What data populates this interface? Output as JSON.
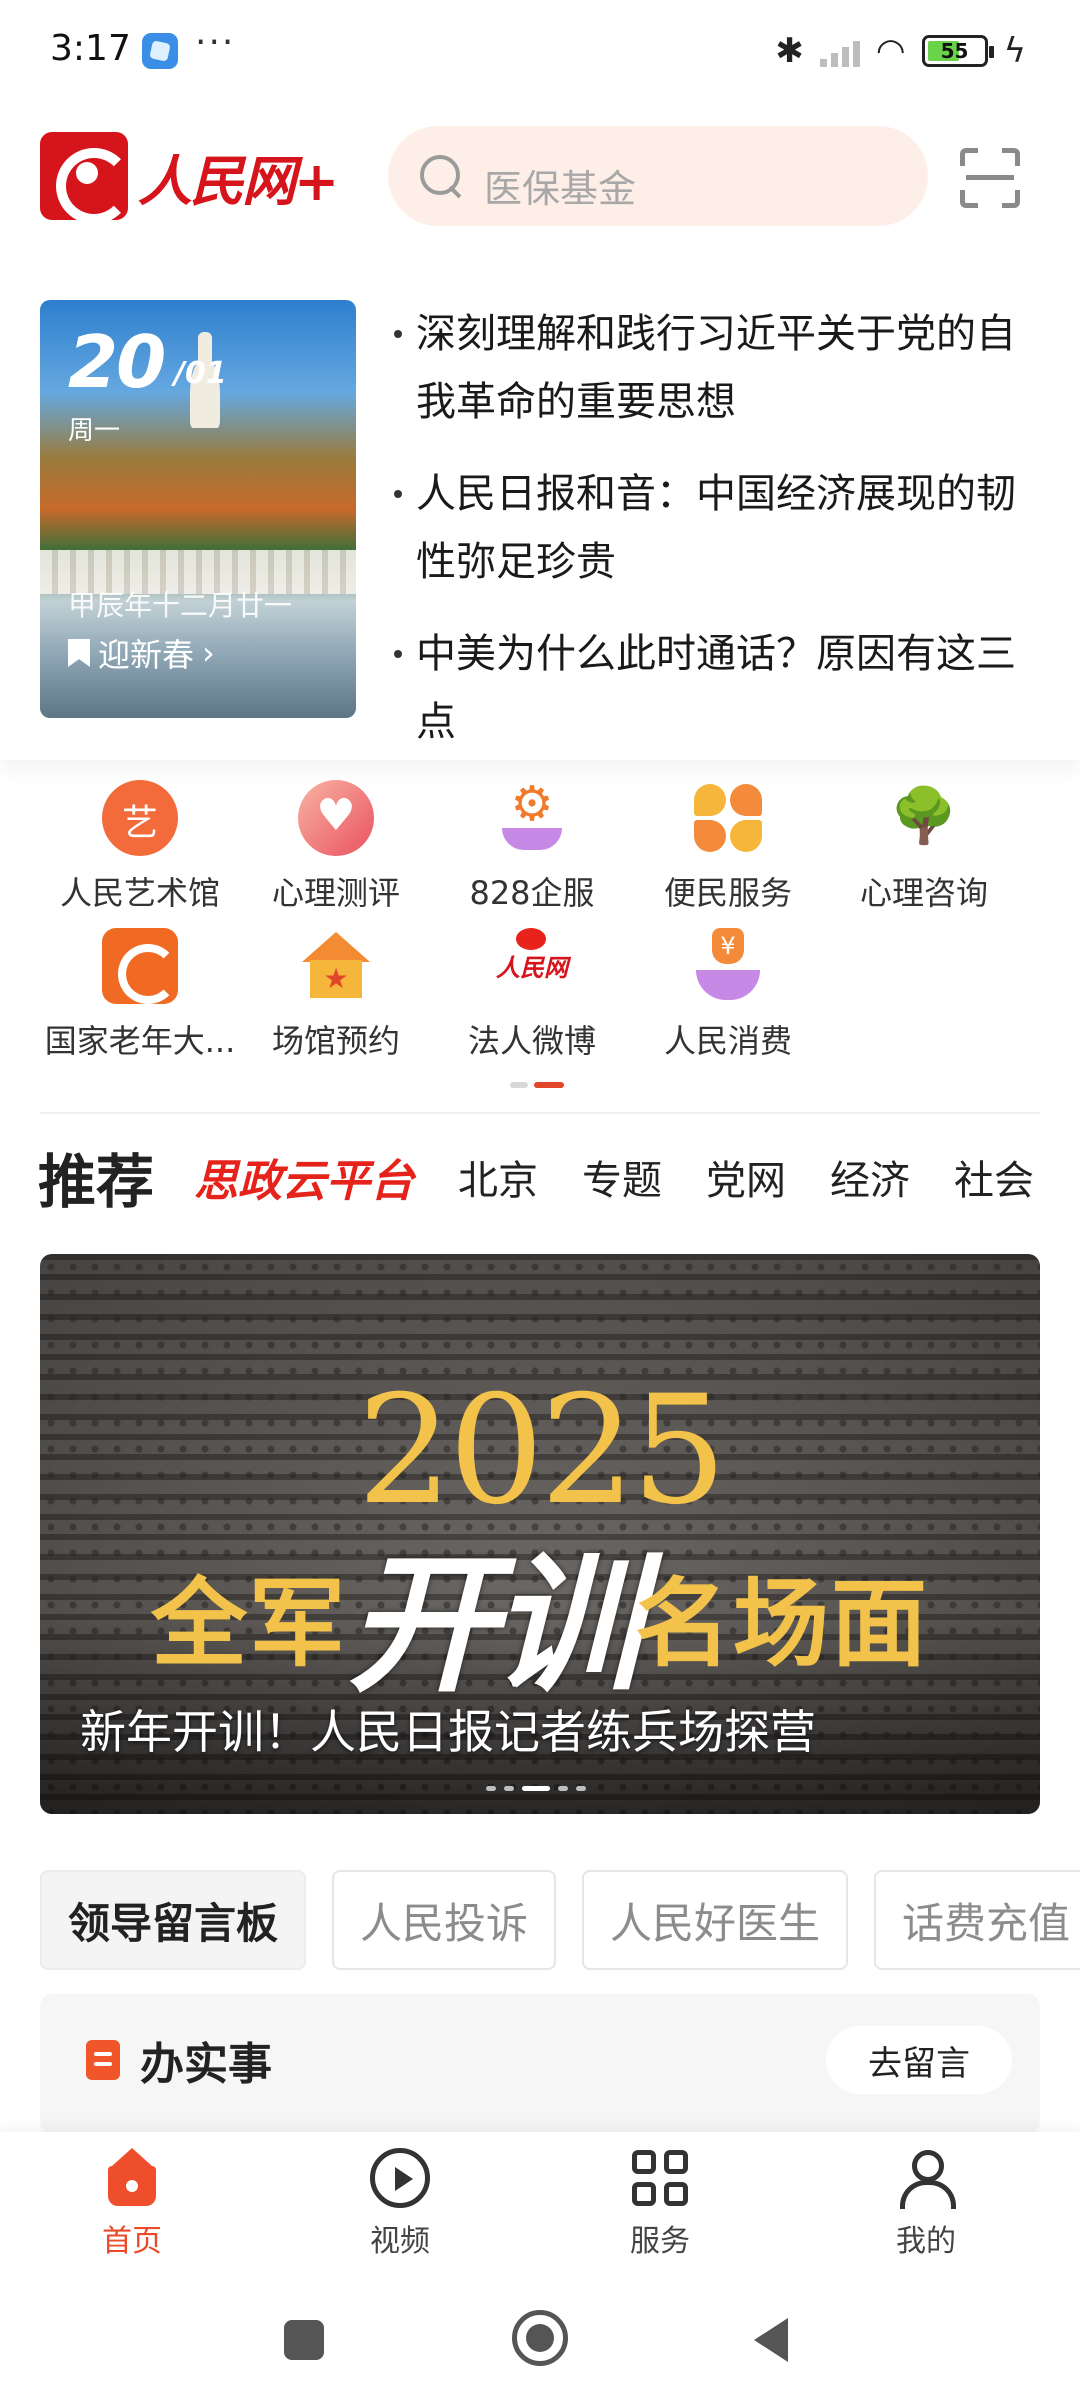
{
  "status_bar": {
    "time": "3:17",
    "more": "···",
    "battery": "55",
    "bluetooth_icon": "bluetooth-icon",
    "wifi_icon": "wifi-icon",
    "charging_icon": "charging-icon"
  },
  "header": {
    "logo_text": "人民网+",
    "search_placeholder": "医保基金",
    "scan_icon": "scan-icon"
  },
  "calendar": {
    "day": "20",
    "month": "/01",
    "weekday": "周一",
    "lunar": "甲辰年十二月廿一",
    "button": "迎新春"
  },
  "headlines": [
    "深刻理解和践行习近平关于党的自我革命的重要思想",
    "人民日报和音：中国经济展现的韧性弥足珍贵",
    "中美为什么此时通话？原因有这三点"
  ],
  "quick_grid": [
    {
      "label": "人民艺术馆",
      "icon": "art-gallery-icon"
    },
    {
      "label": "心理测评",
      "icon": "heart-icon"
    },
    {
      "label": "828企服",
      "icon": "gear-hand-icon"
    },
    {
      "label": "便民服务",
      "icon": "clover-icon"
    },
    {
      "label": "心理咨询",
      "icon": "tree-icon"
    },
    {
      "label": "国家老年大...",
      "icon": "elder-university-icon"
    },
    {
      "label": "场馆预约",
      "icon": "venue-icon"
    },
    {
      "label": "法人微博",
      "icon": "people-weibo-icon"
    },
    {
      "label": "人民消费",
      "icon": "consume-icon"
    }
  ],
  "tabs": {
    "main": "推荐",
    "special": "思政云平台",
    "items": [
      "北京",
      "专题",
      "党网",
      "经济",
      "社会"
    ]
  },
  "banner": {
    "year": "2025",
    "slogan_left": "全军",
    "slogan_mid": "开训",
    "slogan_right": "名场面",
    "caption": "新年开训！人民日报记者练兵场探营"
  },
  "pills": [
    "领导留言板",
    "人民投诉",
    "人民好医生",
    "话费充值"
  ],
  "work_card": {
    "title": "办实事",
    "button": "去留言"
  },
  "bottom_nav": [
    {
      "label": "首页",
      "icon": "home-icon",
      "active": true
    },
    {
      "label": "视频",
      "icon": "play-icon",
      "active": false
    },
    {
      "label": "服务",
      "icon": "grid-icon",
      "active": false
    },
    {
      "label": "我的",
      "icon": "user-icon",
      "active": false
    }
  ],
  "colors": {
    "brand_red": "#d6141b",
    "accent_orange": "#ea4a2a",
    "search_bg": "#fdeee8",
    "banner_gold": "#f2c24a"
  }
}
